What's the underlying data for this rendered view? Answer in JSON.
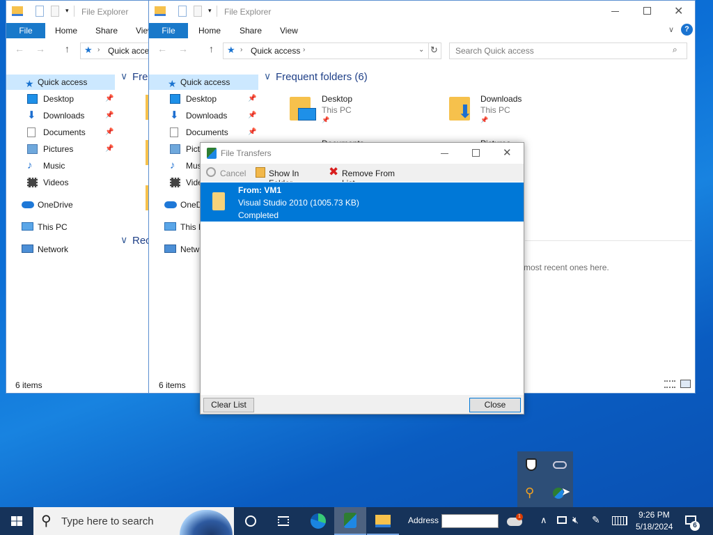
{
  "explorer_back": {
    "title": "File Explorer",
    "ribbon_tabs": [
      "File",
      "Home",
      "Share",
      "View"
    ],
    "address": "Quick access",
    "section_frequent": "Freq",
    "section_recent": "Rec",
    "status": "6 items"
  },
  "explorer_front": {
    "title": "File Explorer",
    "ribbon_tabs": [
      "File",
      "Home",
      "Share",
      "View"
    ],
    "address": "Quick access",
    "search_placeholder": "Search Quick access",
    "frequent_header": "Frequent folders (6)",
    "folders": [
      {
        "name": "Desktop",
        "sub": "This PC"
      },
      {
        "name": "Downloads",
        "sub": "This PC"
      },
      {
        "name": "Documents",
        "sub": ""
      },
      {
        "name": "Pictures",
        "sub": ""
      }
    ],
    "recent_hint": "most recent ones here.",
    "status": "6 items"
  },
  "nav": {
    "quick_access": "Quick access",
    "items": [
      "Desktop",
      "Downloads",
      "Documents",
      "Pictures",
      "Music",
      "Videos"
    ],
    "onedrive": "OneDrive",
    "this_pc": "This PC",
    "network": "Network",
    "front_truncated": [
      "Pict",
      "Mus",
      "Vide",
      "OneD",
      "This P",
      "Netw"
    ]
  },
  "dialog": {
    "title": "File Transfers",
    "toolbar": {
      "cancel": "Cancel",
      "show_in_folder": "Show In Folder",
      "remove_from_list": "Remove From List"
    },
    "transfer": {
      "from": "From: VM1",
      "name": "Visual Studio 2010 (1005.73 KB)",
      "status": "Completed"
    },
    "clear_list": "Clear List",
    "close": "Close"
  },
  "taskbar": {
    "search_placeholder": "Type here to search",
    "address_label": "Address",
    "address_value": "",
    "time": "9:26 PM",
    "date": "5/18/2024",
    "notification_count": "6",
    "cloud_badge": "1"
  },
  "colors": {
    "accent": "#1979ca",
    "selection": "#0078d7",
    "taskbar": "#16335a",
    "desktop": "#0c6fd6"
  }
}
